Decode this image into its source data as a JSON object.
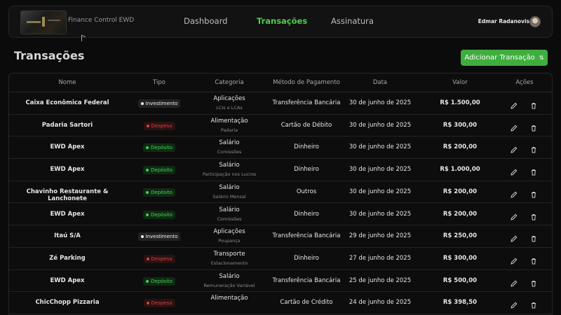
{
  "header": {
    "brand": "Finance Control EWD",
    "nav": [
      {
        "label": "Dashboard",
        "active": false
      },
      {
        "label": "Transações",
        "active": true
      },
      {
        "label": "Assinatura",
        "active": false
      }
    ],
    "user_name": "Edmar Radanovis"
  },
  "page": {
    "title": "Transações",
    "add_button": "Adicionar Transação"
  },
  "table": {
    "columns": [
      "Nome",
      "Tipo",
      "Categoria",
      "Método de Pagamento",
      "Data",
      "Valor",
      "Ações"
    ],
    "rows": [
      {
        "nome": "Caixa Econômica Federal",
        "tipo": "Investimento",
        "tipo_key": "investimento",
        "categoria": "Aplicações",
        "subcategoria": "LCIs e LCAs",
        "metodo": "Transferência Bancária",
        "data": "30 de junho de 2025",
        "valor": "R$ 1.500,00"
      },
      {
        "nome": "Padaria Sartori",
        "tipo": "Despesa",
        "tipo_key": "despesa",
        "categoria": "Alimentação",
        "subcategoria": "Padaria",
        "metodo": "Cartão de Débito",
        "data": "30 de junho de 2025",
        "valor": "R$ 300,00"
      },
      {
        "nome": "EWD Apex",
        "tipo": "Depósito",
        "tipo_key": "deposito",
        "categoria": "Salário",
        "subcategoria": "Comissões",
        "metodo": "Dinheiro",
        "data": "30 de junho de 2025",
        "valor": "R$ 200,00"
      },
      {
        "nome": "EWD Apex",
        "tipo": "Depósito",
        "tipo_key": "deposito",
        "categoria": "Salário",
        "subcategoria": "Participação nos Lucros",
        "metodo": "Dinheiro",
        "data": "30 de junho de 2025",
        "valor": "R$ 1.000,00"
      },
      {
        "nome": "Chavinho Restaurante & Lanchonete",
        "tipo": "Depósito",
        "tipo_key": "deposito",
        "categoria": "Salário",
        "subcategoria": "Salário Mensal",
        "metodo": "Outros",
        "data": "30 de junho de 2025",
        "valor": "R$ 200,00"
      },
      {
        "nome": "EWD Apex",
        "tipo": "Depósito",
        "tipo_key": "deposito",
        "categoria": "Salário",
        "subcategoria": "Comissões",
        "metodo": "Dinheiro",
        "data": "30 de junho de 2025",
        "valor": "R$ 200,00"
      },
      {
        "nome": "Itaú S/A",
        "tipo": "Investimento",
        "tipo_key": "investimento",
        "categoria": "Aplicações",
        "subcategoria": "Poupança",
        "metodo": "Transferência Bancária",
        "data": "29 de junho de 2025",
        "valor": "R$ 250,00"
      },
      {
        "nome": "Zé Parking",
        "tipo": "Despesa",
        "tipo_key": "despesa",
        "categoria": "Transporte",
        "subcategoria": "Estacionamento",
        "metodo": "Dinheiro",
        "data": "27 de junho de 2025",
        "valor": "R$ 300,00"
      },
      {
        "nome": "EWD Apex",
        "tipo": "Depósito",
        "tipo_key": "deposito",
        "categoria": "Salário",
        "subcategoria": "Remuneração Variável",
        "metodo": "Transferência Bancária",
        "data": "25 de junho de 2025",
        "valor": "R$ 500,00"
      },
      {
        "nome": "ChicChopp Pizzaria",
        "tipo": "Despesa",
        "tipo_key": "despesa",
        "categoria": "Alimentação",
        "subcategoria": "",
        "metodo": "Cartão de Crédito",
        "data": "24 de junho de 2025",
        "valor": "R$ 398,50"
      }
    ]
  },
  "icons": {
    "edit": "pencil-icon",
    "delete": "trash-icon",
    "add": "sort-arrows-icon"
  },
  "colors": {
    "accent": "#3fae3f",
    "nav_active": "#4fcf4f",
    "despesa": "#e43a3a",
    "deposito": "#4ccf4c"
  }
}
